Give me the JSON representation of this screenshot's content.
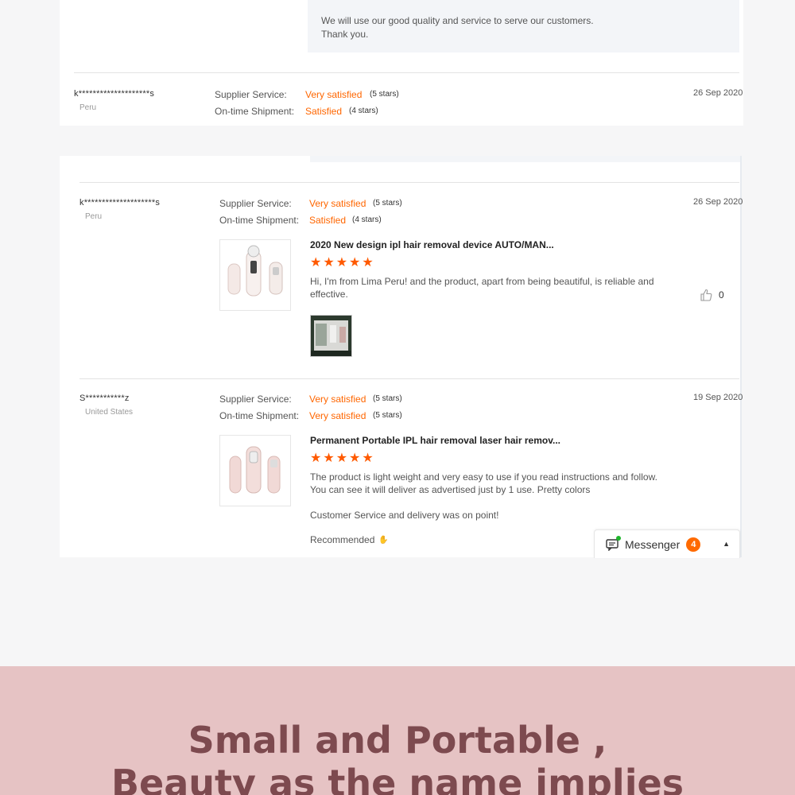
{
  "reply": {
    "line1": "We will use our good quality and service to serve our customers.",
    "line2": "Thank you."
  },
  "labels": {
    "supplier_service": "Supplier Service:",
    "shipment": "On-time Shipment:"
  },
  "reviews": [
    {
      "name": "k********************s",
      "country": "Peru",
      "supplier_value": "Very satisfied",
      "supplier_stars": "(5 stars)",
      "shipment_value": "Satisfied",
      "shipment_stars": "(4 stars)",
      "date": "26 Sep 2020"
    },
    {
      "name": "k********************s",
      "country": "Peru",
      "supplier_value": "Very satisfied",
      "supplier_stars": "(5 stars)",
      "shipment_value": "Satisfied",
      "shipment_stars": "(4 stars)",
      "date": "26 Sep 2020",
      "product_title": "2020 New design ipl hair removal device AUTO/MAN...",
      "rating": 5,
      "body": "Hi, I'm from Lima Peru! and the product, apart from being beautiful, is reliable and effective.",
      "likes": "0"
    },
    {
      "name": "S***********z",
      "country": "United States",
      "supplier_value": "Very satisfied",
      "supplier_stars": "(5 stars)",
      "shipment_value": "Very satisfied",
      "shipment_stars": "(5 stars)",
      "date": "19 Sep 2020",
      "product_title": "Permanent Portable IPL hair removal laser hair remov...",
      "rating": 5,
      "body": "The product is light weight and very easy to use if you read instructions and follow. You can see it will deliver as advertised just by 1 use. Pretty colors",
      "body2": "Customer Service and delivery was on point!",
      "recommended": "Recommended"
    }
  ],
  "messenger": {
    "label": "Messenger",
    "count": "4"
  },
  "banner": {
    "line1": "Small and Portable ,",
    "line2": "Beauty as the name implies"
  },
  "colors": {
    "accent": "#ff6600",
    "star": "#ff5a00",
    "banner_bg": "#e6c3c4",
    "banner_text": "#7d4a4f"
  }
}
